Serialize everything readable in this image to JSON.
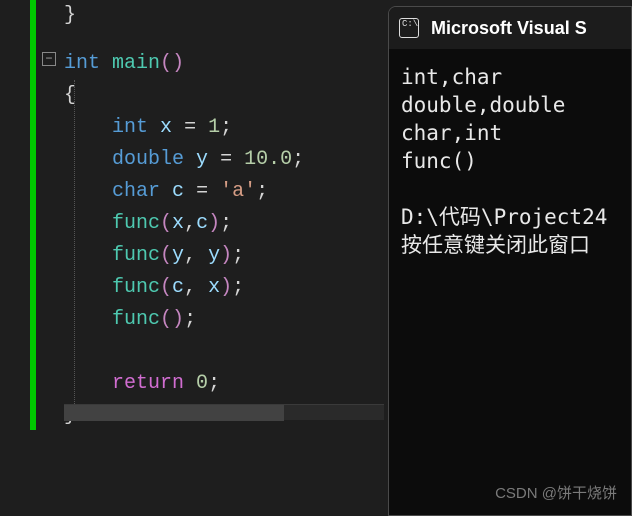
{
  "editor": {
    "fold_symbol": "−",
    "lines": {
      "l0_brace": "}",
      "l1_int": "int",
      "l1_main": "main",
      "l1_po": "(",
      "l1_pc": ")",
      "l2_brace": "{",
      "l3_int": "int",
      "l3_x": "x",
      "l3_eq": " = ",
      "l3_1": "1",
      "l3_sc": ";",
      "l4_double": "double",
      "l4_y": "y",
      "l4_eq": " = ",
      "l4_10": "10.0",
      "l4_sc": ";",
      "l5_char": "char",
      "l5_c": "c",
      "l5_eq": " = ",
      "l5_a": "'a'",
      "l5_sc": ";",
      "l6_func": "func",
      "l6_po": "(",
      "l6_x": "x",
      "l6_comma": ",",
      "l6_c": "c",
      "l6_pc": ")",
      "l6_sc": ";",
      "l7_func": "func",
      "l7_po": "(",
      "l7_y": "y",
      "l7_comma": ", ",
      "l7_y2": "y",
      "l7_pc": ")",
      "l7_sc": ";",
      "l8_func": "func",
      "l8_po": "(",
      "l8_c": "c",
      "l8_comma": ", ",
      "l8_x": "x",
      "l8_pc": ")",
      "l8_sc": ";",
      "l9_func": "func",
      "l9_po": "(",
      "l9_pc": ")",
      "l9_sc": ";",
      "l11_return": "return",
      "l11_0": "0",
      "l11_sc": ";",
      "l12_brace": "}"
    }
  },
  "console": {
    "title": "Microsoft Visual S",
    "term_icon_text": "C:\\",
    "output": "int,char\ndouble,double\nchar,int\nfunc()\n\nD:\\代码\\Project24\n按任意键关闭此窗口"
  },
  "watermark": "CSDN @饼干烧饼"
}
